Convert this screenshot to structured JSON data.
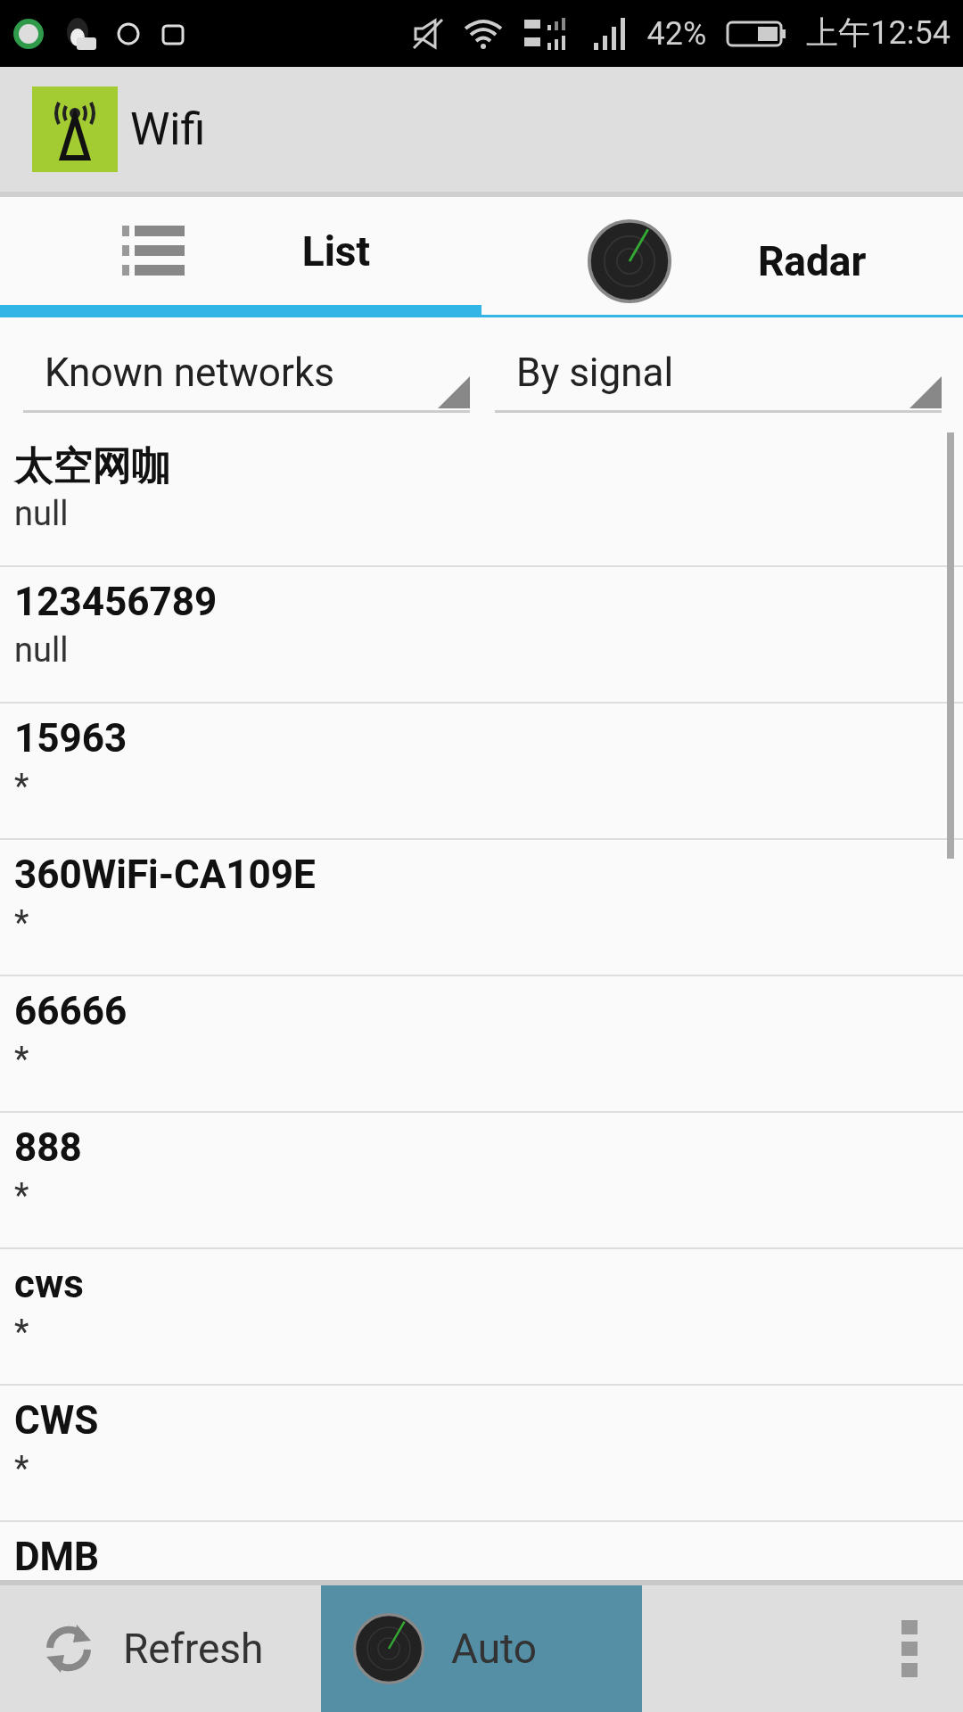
{
  "status_bar": {
    "battery": "42%",
    "time": "上午12:54"
  },
  "app_bar": {
    "title": "Wifi"
  },
  "tabs": [
    {
      "label": "List",
      "kind": "list",
      "selected": true
    },
    {
      "label": "Radar",
      "kind": "radar",
      "selected": false
    }
  ],
  "filters": [
    {
      "value": "Known networks"
    },
    {
      "value": "By signal"
    }
  ],
  "networks": [
    {
      "name": "太空网咖",
      "detail": "null"
    },
    {
      "name": "123456789",
      "detail": "null"
    },
    {
      "name": "15963",
      "detail": "*"
    },
    {
      "name": "360WiFi-CA109E",
      "detail": "*"
    },
    {
      "name": "66666",
      "detail": "*"
    },
    {
      "name": "888",
      "detail": "*"
    },
    {
      "name": "cws",
      "detail": "*"
    },
    {
      "name": "CWS",
      "detail": "*"
    },
    {
      "name": "DMB"
    }
  ],
  "bottom_bar": {
    "refresh": {
      "label": "Refresh"
    },
    "auto": {
      "label": "Auto",
      "on": true
    }
  }
}
